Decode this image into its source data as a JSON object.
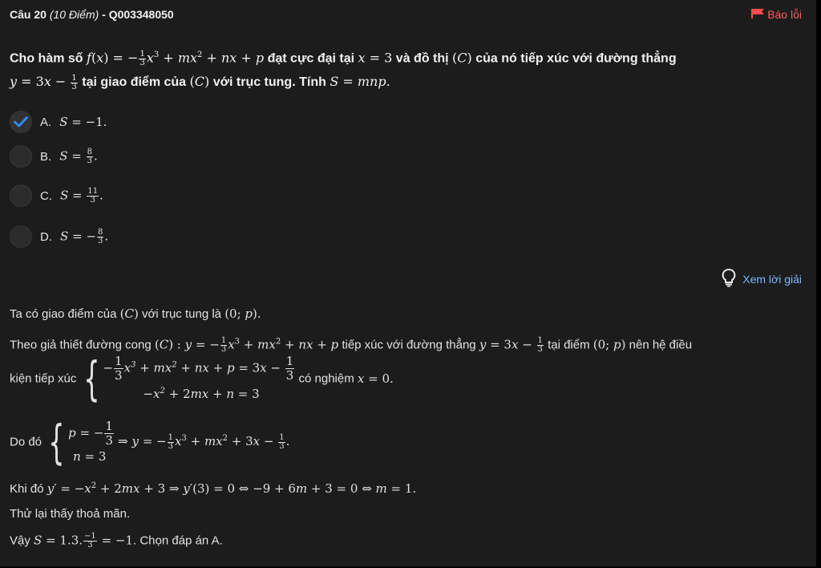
{
  "header": {
    "question_label": "Câu 20",
    "points": "(10 Điểm)",
    "code": "- Q003348050",
    "report_label": "Báo lỗi"
  },
  "question": {
    "line1_a": "Cho hàm số",
    "line1_b": "đạt cực đại tại",
    "line1_c": "và đồ thị",
    "line1_d": "của nó tiếp xúc với đường thẳng",
    "line2_a": "tại giao điểm của",
    "line2_b": "với trục tung. Tính"
  },
  "options": [
    {
      "letter": "A.",
      "value": "S = −1.",
      "selected": true
    },
    {
      "letter": "B.",
      "value": "S = 8/3.",
      "selected": false
    },
    {
      "letter": "C.",
      "value": "S = 11/3.",
      "selected": false
    },
    {
      "letter": "D.",
      "value": "S = −8/3.",
      "selected": false
    }
  ],
  "view_solution_label": "Xem lời giải",
  "solution": {
    "l1": "Ta có giao điểm của",
    "l1b": "với trục tung là",
    "l2a": "Theo giả thiết đường cong",
    "l2b": "tiếp xúc với đường thẳng",
    "l2c": "tại điểm",
    "l2d": "nên hệ điều",
    "l3a": "kiện tiếp xúc",
    "l3b": "có nghiệm",
    "l4a": "Do đó",
    "l5a": "Khi đó",
    "l6": "Thử lại thấy thoả mãn.",
    "l7a": "Vậy",
    "l7b": ". Chọn đáp án A."
  },
  "colors": {
    "accent_check": "#2f8cff",
    "report": "#ff5b5b",
    "link": "#7ab7ff"
  }
}
